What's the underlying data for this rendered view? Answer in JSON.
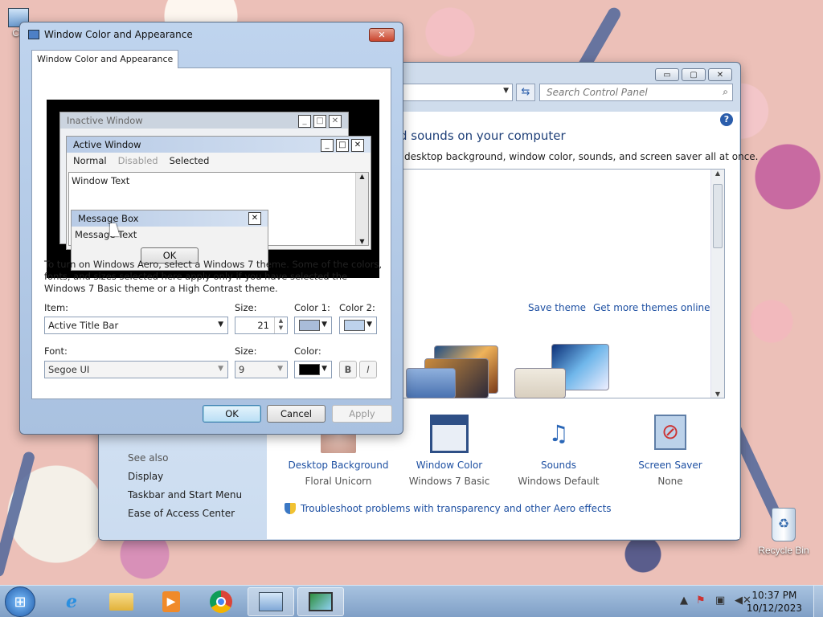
{
  "desktop": {
    "icons": [
      {
        "label": "Co"
      },
      {
        "label": "Recycle Bin"
      }
    ]
  },
  "control_panel": {
    "address": "n",
    "search_placeholder": "Search Control Panel",
    "heading": "d sounds on your computer",
    "subheading": "desktop background, window color, sounds, and screen saver all at once.",
    "links": {
      "save_theme": "Save theme",
      "get_more": "Get more themes online"
    },
    "tiles": [
      {
        "label": "Desktop Background",
        "sub": "Floral Unicorn"
      },
      {
        "label": "Window Color",
        "sub": "Windows 7 Basic"
      },
      {
        "label": "Sounds",
        "sub": "Windows Default"
      },
      {
        "label": "Screen Saver",
        "sub": "None"
      }
    ],
    "see_also": {
      "title": "See also",
      "items": [
        "Display",
        "Taskbar and Start Menu",
        "Ease of Access Center"
      ]
    },
    "troubleshoot": "Troubleshoot problems with transparency and other Aero effects"
  },
  "dialog": {
    "title": "Window Color and Appearance",
    "tab": "Window Color and Appearance",
    "preview": {
      "inactive_window": "Inactive Window",
      "active_window": "Active Window",
      "menu": [
        "Normal",
        "Disabled",
        "Selected"
      ],
      "window_text": "Window Text",
      "message_box": "Message Box",
      "message_text": "Message Text",
      "ok": "OK"
    },
    "note": "To turn on Windows Aero, select a Windows 7 theme.  Some of the colors, fonts, and sizes selected here apply only if you have selected the Windows 7 Basic theme or a High Contrast theme.",
    "item_label": "Item:",
    "item_value": "Active Title Bar",
    "size_label": "Size:",
    "size_value": "21",
    "color1_label": "Color 1:",
    "color2_label": "Color 2:",
    "color1": "#a9bcd9",
    "color2": "#bdd2ec",
    "font_label": "Font:",
    "font_value": "Segoe UI",
    "font_size_label": "Size:",
    "font_size_value": "9",
    "font_color_label": "Color:",
    "font_color": "#000000",
    "bold": "B",
    "italic": "I",
    "buttons": {
      "ok": "OK",
      "cancel": "Cancel",
      "apply": "Apply"
    }
  },
  "taskbar": {
    "time": "10:37 PM",
    "date": "10/12/2023"
  }
}
